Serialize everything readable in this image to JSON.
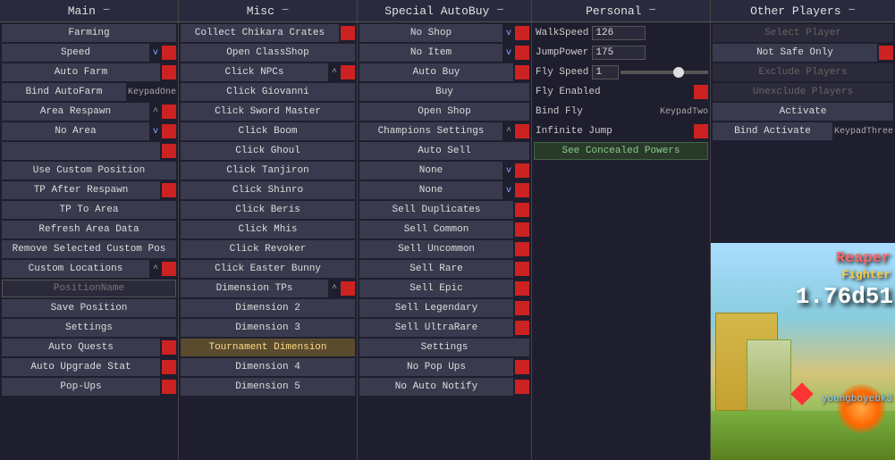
{
  "panels": {
    "main": {
      "title": "Main",
      "buttons": [
        {
          "label": "Farming",
          "type": "full"
        },
        {
          "label": "Speed",
          "type": "row",
          "indicator": "v"
        },
        {
          "label": "Auto Farm",
          "type": "row-red"
        },
        {
          "label": "Bind AutoFarm",
          "type": "row-key",
          "key": "KeypadOne"
        },
        {
          "label": "Area Respawn",
          "type": "row",
          "indicator": "^"
        },
        {
          "label": "No Area",
          "type": "row",
          "indicator": "v"
        },
        {
          "label": "",
          "type": "row",
          "indicator": "ha"
        },
        {
          "label": "Use Custom Position",
          "type": "full"
        },
        {
          "label": "TP After Respawn",
          "type": "row-red"
        },
        {
          "label": "TP To Area",
          "type": "full"
        },
        {
          "label": "Refresh Area Data",
          "type": "full"
        },
        {
          "label": "Remove Selected Custom Pos",
          "type": "full"
        },
        {
          "label": "Custom Locations",
          "type": "row",
          "indicator": "^"
        },
        {
          "label": "PositionName",
          "type": "input"
        },
        {
          "label": "Save Position",
          "type": "full"
        },
        {
          "label": "Settings",
          "type": "full"
        },
        {
          "label": "Auto Quests",
          "type": "row-red"
        },
        {
          "label": "Auto Upgrade Stat",
          "type": "row-red"
        },
        {
          "label": "Pop-Ups",
          "type": "row-red"
        }
      ]
    },
    "misc": {
      "title": "Misc",
      "buttons": [
        {
          "label": "Collect Chikara Crates",
          "type": "row-red"
        },
        {
          "label": "Open ClassShop",
          "type": "full"
        },
        {
          "label": "Click NPCs",
          "type": "row",
          "indicator": "^"
        },
        {
          "label": "Click Giovanni",
          "type": "full"
        },
        {
          "label": "Click Sword Master",
          "type": "full"
        },
        {
          "label": "Click Boom",
          "type": "full"
        },
        {
          "label": "Click Ghoul",
          "type": "full"
        },
        {
          "label": "Click Tanjiron",
          "type": "full"
        },
        {
          "label": "Click Shinro",
          "type": "full"
        },
        {
          "label": "Click Beris",
          "type": "full"
        },
        {
          "label": "Click Mhis",
          "type": "full"
        },
        {
          "label": "Click Revoker",
          "type": "full"
        },
        {
          "label": "Click Easter Bunny",
          "type": "full"
        },
        {
          "label": "Dimension TPs",
          "type": "row",
          "indicator": "^"
        },
        {
          "label": "Dimension 2",
          "type": "full"
        },
        {
          "label": "Dimension 3",
          "type": "full"
        },
        {
          "label": "Tournament Dimension",
          "type": "full-highlight"
        },
        {
          "label": "Dimension 4",
          "type": "full"
        },
        {
          "label": "Dimension 5",
          "type": "full"
        }
      ]
    },
    "special": {
      "title": "Special AutoBuy",
      "buttons": [
        {
          "label": "No Shop",
          "type": "row-v"
        },
        {
          "label": "No Item",
          "type": "row-v"
        },
        {
          "label": "Auto Buy",
          "type": "row-red"
        },
        {
          "label": "Buy",
          "type": "full"
        },
        {
          "label": "Open Shop",
          "type": "full"
        },
        {
          "label": "Champions Settings",
          "type": "row",
          "indicator": "^"
        },
        {
          "label": "Auto Sell",
          "type": "full"
        },
        {
          "label": "None",
          "type": "row-v"
        },
        {
          "label": "None",
          "type": "row-v"
        },
        {
          "label": "Sell Duplicates",
          "type": "row-red"
        },
        {
          "label": "Sell Common",
          "type": "row-red"
        },
        {
          "label": "Sell Uncommon",
          "type": "row-red"
        },
        {
          "label": "Sell Rare",
          "type": "row-red"
        },
        {
          "label": "Sell Epic",
          "type": "row-red"
        },
        {
          "label": "Sell Legendary",
          "type": "row-red"
        },
        {
          "label": "Sell UltraRare",
          "type": "row-red"
        },
        {
          "label": "Settings",
          "type": "full"
        },
        {
          "label": "No Pop Ups",
          "type": "row-red"
        },
        {
          "label": "No Auto Notify",
          "type": "row-red"
        }
      ]
    },
    "personal": {
      "title": "Personal",
      "fields": [
        {
          "label": "WalkSpeed",
          "value": "126"
        },
        {
          "label": "JumpPower",
          "value": "175"
        },
        {
          "label": "Fly Speed",
          "value": "1"
        },
        {
          "label": "Fly Enabled",
          "type": "red"
        },
        {
          "label": "Bind Fly",
          "key": "KeypadTwo"
        },
        {
          "label": "Infinite Jump",
          "type": "red"
        },
        {
          "label": "See Concealed Powers",
          "type": "special-btn"
        }
      ]
    },
    "other": {
      "title": "Other Players",
      "buttons": [
        {
          "label": "Select Player",
          "type": "disabled"
        },
        {
          "label": "Not Safe Only",
          "type": "row-red"
        },
        {
          "label": "Exclude Players",
          "type": "disabled"
        },
        {
          "label": "Unexclude Players",
          "type": "disabled"
        },
        {
          "label": "Activate",
          "type": "full"
        },
        {
          "label": "Bind Activate",
          "type": "row-key",
          "key": "KeypadThree"
        }
      ]
    }
  },
  "game": {
    "character_class": "Reaper",
    "character_type": "Fighter",
    "big_number": "1.76d51",
    "username": "youngboyebk3"
  }
}
